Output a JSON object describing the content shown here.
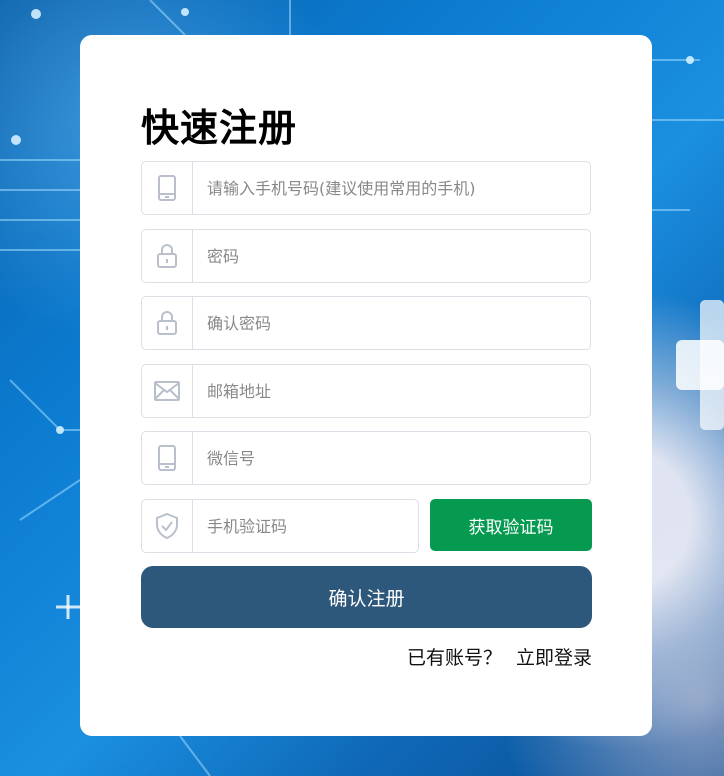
{
  "page": {
    "title": "快速注册"
  },
  "form": {
    "phone": {
      "placeholder": "请输入手机号码(建议使用常用的手机)",
      "icon": "phone-icon"
    },
    "password": {
      "placeholder": "密码",
      "icon": "lock-icon"
    },
    "confirm_password": {
      "placeholder": "确认密码",
      "icon": "lock-icon"
    },
    "email": {
      "placeholder": "邮箱地址",
      "icon": "mail-icon"
    },
    "wechat": {
      "placeholder": "微信号",
      "icon": "phone-icon"
    },
    "sms_code": {
      "placeholder": "手机验证码",
      "icon": "shield-check-icon"
    },
    "get_code_label": "获取验证码",
    "submit_label": "确认注册"
  },
  "footer": {
    "have_account": "已有账号？",
    "login_link": "立即登录"
  },
  "colors": {
    "code_button": "#059a4f",
    "submit_button": "#2e587b",
    "icon": "#b9c0cc",
    "border": "#dcdfe6"
  }
}
